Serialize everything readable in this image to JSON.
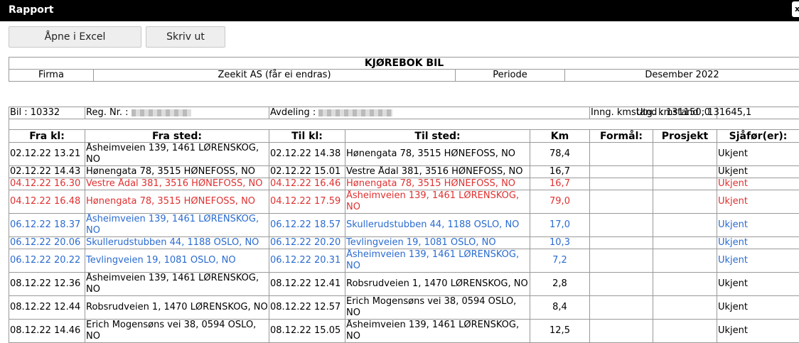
{
  "window": {
    "title": "Rapport",
    "close_label": "x"
  },
  "toolbar": {
    "excel_label": "Åpne i Excel",
    "print_label": "Skriv ut"
  },
  "report": {
    "heading": "KJØREBOK BIL",
    "firma_label": "Firma",
    "firma_value": "Zeekit AS (får ei endras)",
    "periode_label": "Periode",
    "periode_value": "Desember 2022"
  },
  "vehicle": {
    "bil": "Bil : 10332",
    "reg_label": "Reg. Nr. :",
    "avdeling_label": "Avdeling :",
    "inng": "Inng. kmstand : 131150,0",
    "utg": "Utg. kmstand : 131645,1"
  },
  "columns": [
    "Fra kl:",
    "Fra sted:",
    "Til kl:",
    "Til sted:",
    "Km",
    "Formål:",
    "Prosjekt",
    "Sjåfør(er):"
  ],
  "rows": [
    {
      "fra_kl": "02.12.22 13.21",
      "fra_sted": "Åsheimveien 139, 1461 LØRENSKOG, NO",
      "til_kl": "02.12.22 14.38",
      "til_sted": "Hønengata 78, 3515 HØNEFOSS, NO",
      "km": "78,4",
      "formal": "",
      "prosjekt": "",
      "sjafor": "Ukjent",
      "color": "black"
    },
    {
      "fra_kl": "02.12.22 14.43",
      "fra_sted": "Hønengata 78, 3515 HØNEFOSS, NO",
      "til_kl": "02.12.22 15.01",
      "til_sted": "Vestre Ådal 381, 3516 HØNEFOSS, NO",
      "km": "16,7",
      "formal": "",
      "prosjekt": "",
      "sjafor": "Ukjent",
      "color": "black"
    },
    {
      "fra_kl": "04.12.22 16.30",
      "fra_sted": "Vestre Ådal 381, 3516 HØNEFOSS, NO",
      "til_kl": "04.12.22 16.46",
      "til_sted": "Hønengata 78, 3515 HØNEFOSS, NO",
      "km": "16,7",
      "formal": "",
      "prosjekt": "",
      "sjafor": "Ukjent",
      "color": "red"
    },
    {
      "fra_kl": "04.12.22 16.48",
      "fra_sted": "Hønengata 78, 3515 HØNEFOSS, NO",
      "til_kl": "04.12.22 17.59",
      "til_sted": "Åsheimveien 139, 1461 LØRENSKOG, NO",
      "km": "79,0",
      "formal": "",
      "prosjekt": "",
      "sjafor": "Ukjent",
      "color": "red"
    },
    {
      "fra_kl": "06.12.22 18.37",
      "fra_sted": "Åsheimveien 139, 1461 LØRENSKOG, NO",
      "til_kl": "06.12.22 18.57",
      "til_sted": "Skullerudstubben 44, 1188 OSLO, NO",
      "km": "17,0",
      "formal": "",
      "prosjekt": "",
      "sjafor": "Ukjent",
      "color": "blue"
    },
    {
      "fra_kl": "06.12.22 20.06",
      "fra_sted": "Skullerudstubben 44, 1188 OSLO, NO",
      "til_kl": "06.12.22 20.20",
      "til_sted": "Tevlingveien 19, 1081 OSLO, NO",
      "km": "10,3",
      "formal": "",
      "prosjekt": "",
      "sjafor": "Ukjent",
      "color": "blue"
    },
    {
      "fra_kl": "06.12.22 20.22",
      "fra_sted": "Tevlingveien 19, 1081 OSLO, NO",
      "til_kl": "06.12.22 20.31",
      "til_sted": "Åsheimveien 139, 1461 LØRENSKOG, NO",
      "km": "7,2",
      "formal": "",
      "prosjekt": "",
      "sjafor": "Ukjent",
      "color": "blue"
    },
    {
      "fra_kl": "08.12.22 12.36",
      "fra_sted": "Åsheimveien 139, 1461 LØRENSKOG, NO",
      "til_kl": "08.12.22 12.41",
      "til_sted": "Robsrudveien 1, 1470 LØRENSKOG, NO",
      "km": "2,8",
      "formal": "",
      "prosjekt": "",
      "sjafor": "Ukjent",
      "color": "black"
    },
    {
      "fra_kl": "08.12.22 12.44",
      "fra_sted": "Robsrudveien 1, 1470 LØRENSKOG, NO",
      "til_kl": "08.12.22 12.57",
      "til_sted": "Erich Mogensøns vei 38, 0594 OSLO, NO",
      "km": "8,4",
      "formal": "",
      "prosjekt": "",
      "sjafor": "Ukjent",
      "color": "black"
    },
    {
      "fra_kl": "08.12.22 14.46",
      "fra_sted": "Erich Mogensøns vei 38, 0594 OSLO, NO",
      "til_kl": "08.12.22 15.05",
      "til_sted": "Åsheimveien 139, 1461 LØRENSKOG, NO",
      "km": "12,5",
      "formal": "",
      "prosjekt": "",
      "sjafor": "Ukjent",
      "color": "black"
    }
  ]
}
